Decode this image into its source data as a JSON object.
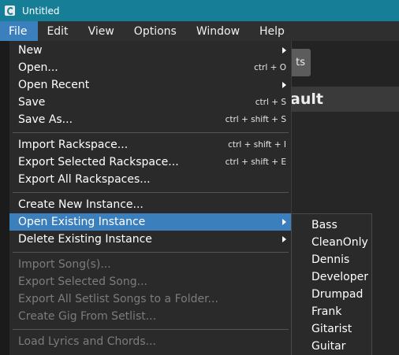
{
  "window": {
    "title": "Untitled"
  },
  "menubar": {
    "items": [
      "File",
      "Edit",
      "View",
      "Options",
      "Window",
      "Help"
    ]
  },
  "background": {
    "button_label": "ts",
    "header_text": "ault"
  },
  "file_menu": {
    "items": [
      {
        "label": "New",
        "shortcut": "",
        "submenu": true,
        "disabled": false
      },
      {
        "label": "Open...",
        "shortcut": "ctrl + O",
        "submenu": false,
        "disabled": false
      },
      {
        "label": "Open Recent",
        "shortcut": "",
        "submenu": true,
        "disabled": false
      },
      {
        "label": "Save",
        "shortcut": "ctrl + S",
        "submenu": false,
        "disabled": false
      },
      {
        "label": "Save As...",
        "shortcut": "ctrl + shift + S",
        "submenu": false,
        "disabled": false
      },
      {
        "label": "Import Rackspace...",
        "shortcut": "ctrl + shift + I",
        "submenu": false,
        "disabled": false
      },
      {
        "label": "Export Selected Rackspace...",
        "shortcut": "ctrl + shift + E",
        "submenu": false,
        "disabled": false
      },
      {
        "label": "Export All Rackspaces...",
        "shortcut": "",
        "submenu": false,
        "disabled": false
      },
      {
        "label": "Create New Instance...",
        "shortcut": "",
        "submenu": false,
        "disabled": false
      },
      {
        "label": "Open Existing Instance",
        "shortcut": "",
        "submenu": true,
        "disabled": false
      },
      {
        "label": "Delete Existing Instance",
        "shortcut": "",
        "submenu": true,
        "disabled": false
      },
      {
        "label": "Import Song(s)...",
        "shortcut": "",
        "submenu": false,
        "disabled": true
      },
      {
        "label": "Export Selected Song...",
        "shortcut": "",
        "submenu": false,
        "disabled": true
      },
      {
        "label": "Export All Setlist Songs to a Folder...",
        "shortcut": "",
        "submenu": false,
        "disabled": true
      },
      {
        "label": "Create Gig From Setlist...",
        "shortcut": "",
        "submenu": false,
        "disabled": true
      },
      {
        "label": "Load Lyrics and Chords...",
        "shortcut": "",
        "submenu": false,
        "disabled": true
      }
    ]
  },
  "instance_submenu": {
    "items": [
      "Bass",
      "CleanOnly",
      "Dennis",
      "Developer",
      "Drumpad",
      "Frank",
      "Gitarist",
      "Guitar"
    ]
  },
  "colors": {
    "titlebar": "#177e98",
    "menubar": "#2f2f2f",
    "menu_bg": "#2a2a2a",
    "highlight": "#3b7fbd",
    "disabled_text": "#7c7c7c"
  }
}
